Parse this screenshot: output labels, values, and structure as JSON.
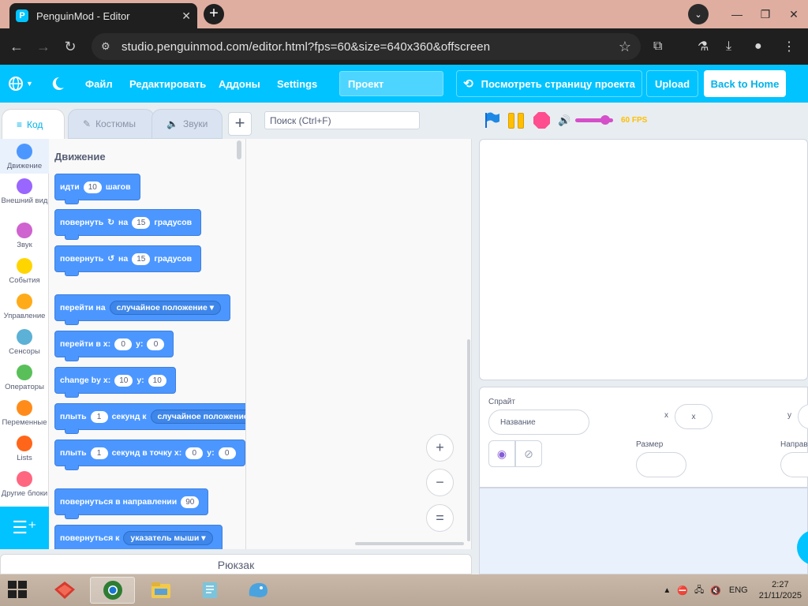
{
  "browser": {
    "tab_title": "PenguinMod - Editor",
    "tab_icon_letter": "P",
    "url": "studio.penguinmod.com/editor.html?fps=60&size=640x360&offscreen",
    "new_tab_glyph": "+",
    "close_glyph": "✕",
    "minimize_glyph": "—",
    "restore_glyph": "❐",
    "window_close_glyph": "✕",
    "tabsearch_glyph": "⌄"
  },
  "menu": {
    "file": "Файл",
    "edit": "Редактировать",
    "addons": "Аддоны",
    "settings": "Settings",
    "project_title": "Проект",
    "see_project": "Посмотреть страницу проекта",
    "upload": "Upload",
    "back_home": "Back to Home"
  },
  "tabs": {
    "code": "Код",
    "costumes": "Костюмы",
    "sounds": "Звуки"
  },
  "search": {
    "placeholder": "Поиск (Ctrl+F)"
  },
  "categories": [
    {
      "label": "Движение",
      "color": "#4c97ff"
    },
    {
      "label": "Внешний вид",
      "color": "#9966ff"
    },
    {
      "label": "Звук",
      "color": "#cf63cf"
    },
    {
      "label": "События",
      "color": "#ffd500"
    },
    {
      "label": "Управление",
      "color": "#ffab19"
    },
    {
      "label": "Сенсоры",
      "color": "#5cb1d6"
    },
    {
      "label": "Операторы",
      "color": "#59c059"
    },
    {
      "label": "Переменные",
      "color": "#ff8c1a"
    },
    {
      "label": "Lists",
      "color": "#ff661a"
    },
    {
      "label": "Другие блоки",
      "color": "#ff6680"
    }
  ],
  "palette": {
    "title": "Движение",
    "blocks": {
      "move": {
        "w1": "идти",
        "v1": "10",
        "w2": "шагов"
      },
      "turn_right": {
        "w1": "повернуть",
        "w2": "на",
        "v1": "15",
        "w3": "градусов"
      },
      "turn_left": {
        "w1": "повернуть",
        "w2": "на",
        "v1": "15",
        "w3": "градусов"
      },
      "goto": {
        "w1": "перейти на",
        "dd": "случайное положение"
      },
      "goto_xy": {
        "w1": "перейти в x:",
        "v1": "0",
        "w2": "y:",
        "v2": "0"
      },
      "change_by": {
        "w1": "change by x:",
        "v1": "10",
        "w2": "y:",
        "v2": "10"
      },
      "glide": {
        "w1": "плыть",
        "v1": "1",
        "w2": "секунд к",
        "dd": "случайное положение"
      },
      "glide_xy": {
        "w1": "плыть",
        "v1": "1",
        "w2": "секунд в точку x:",
        "v2": "0",
        "w3": "y:",
        "v3": "0"
      },
      "point_dir": {
        "w1": "повернуться в направлении",
        "v1": "90"
      },
      "point_to": {
        "w1": "повернуться к",
        "dd": "указатель мыши"
      }
    }
  },
  "zoom": {
    "in": "+",
    "out": "−",
    "reset": "="
  },
  "backpack": "Рюкзак",
  "stage": {
    "fps_label": "60 FPS",
    "volume_level": 0.8
  },
  "sprite_info": {
    "sprite_label": "Спрайт",
    "name_placeholder": "Название",
    "x_label": "x",
    "x_placeholder": "x",
    "y_label": "y",
    "size_label": "Размер",
    "direction_label": "Направ"
  },
  "taskbar": {
    "lang": "ENG",
    "time": "2:27",
    "date": "21/11/2025"
  },
  "colors": {
    "accent": "#00c3ff",
    "motion_block": "#4c97ff",
    "control_yellow": "#ffbf00",
    "stop_pink": "#ff4d8f",
    "sound_purple": "#d44fc9"
  }
}
